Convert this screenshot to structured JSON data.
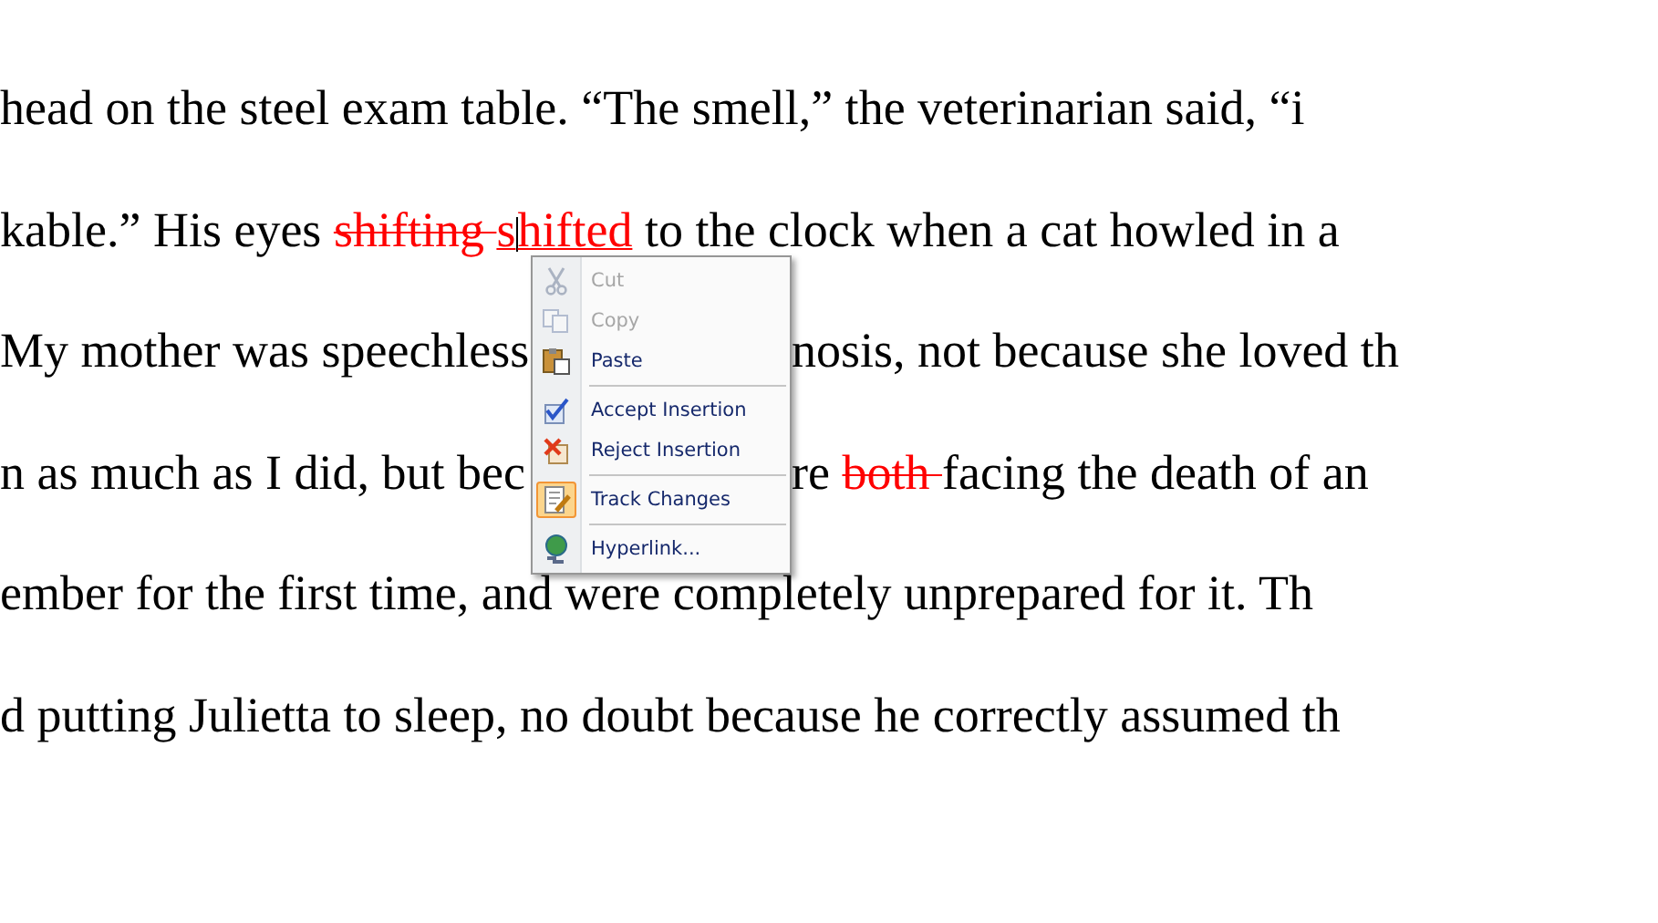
{
  "document": {
    "lines": [
      {
        "left": [
          {
            "kind": "normal",
            "text": "head on the steel exam table. “The smell,” the veterinarian said, “i"
          }
        ]
      },
      {
        "left": [
          {
            "kind": "normal",
            "text": "kable.” His eyes "
          },
          {
            "kind": "deleted",
            "text": "shifting "
          },
          {
            "kind": "inserted",
            "text": "s",
            "cursor": true
          },
          {
            "kind": "inserted",
            "text": "hifted",
            "cursor": false
          },
          {
            "kind": "normal",
            "text": " to the clock when a cat howled in a"
          }
        ]
      },
      {
        "left": [
          {
            "kind": "normal",
            "text": "My mother was speechless"
          }
        ],
        "right": [
          {
            "kind": "normal",
            "text": "nosis, not because she loved th"
          }
        ]
      },
      {
        "left": [
          {
            "kind": "normal",
            "text": "n as much as I did, but bec"
          }
        ],
        "right": [
          {
            "kind": "normal",
            "text": "re "
          },
          {
            "kind": "deleted",
            "text": "both "
          },
          {
            "kind": "normal",
            "text": "facing the death of an"
          }
        ]
      },
      {
        "left": [
          {
            "kind": "normal",
            "text": "ember for the first time, and were completely unprepared for it. Th"
          }
        ]
      },
      {
        "left": [
          {
            "kind": "normal",
            "text": "d putting Julietta to sleep, no doubt because he correctly assumed th"
          }
        ]
      }
    ]
  },
  "context_menu": {
    "items": [
      {
        "kind": "item",
        "label": "Cut",
        "disabled": true,
        "checked": false
      },
      {
        "kind": "item",
        "label": "Copy",
        "disabled": true,
        "checked": false
      },
      {
        "kind": "item",
        "label": "Paste",
        "disabled": false,
        "checked": false
      },
      {
        "kind": "separator"
      },
      {
        "kind": "item",
        "label": "Accept Insertion",
        "disabled": false,
        "checked": false
      },
      {
        "kind": "item",
        "label": "Reject Insertion",
        "disabled": false,
        "checked": false
      },
      {
        "kind": "separator"
      },
      {
        "kind": "item",
        "label": "Track Changes",
        "disabled": false,
        "checked": true
      },
      {
        "kind": "separator"
      },
      {
        "kind": "item",
        "label": "Hyperlink...",
        "disabled": false,
        "checked": false
      }
    ]
  }
}
